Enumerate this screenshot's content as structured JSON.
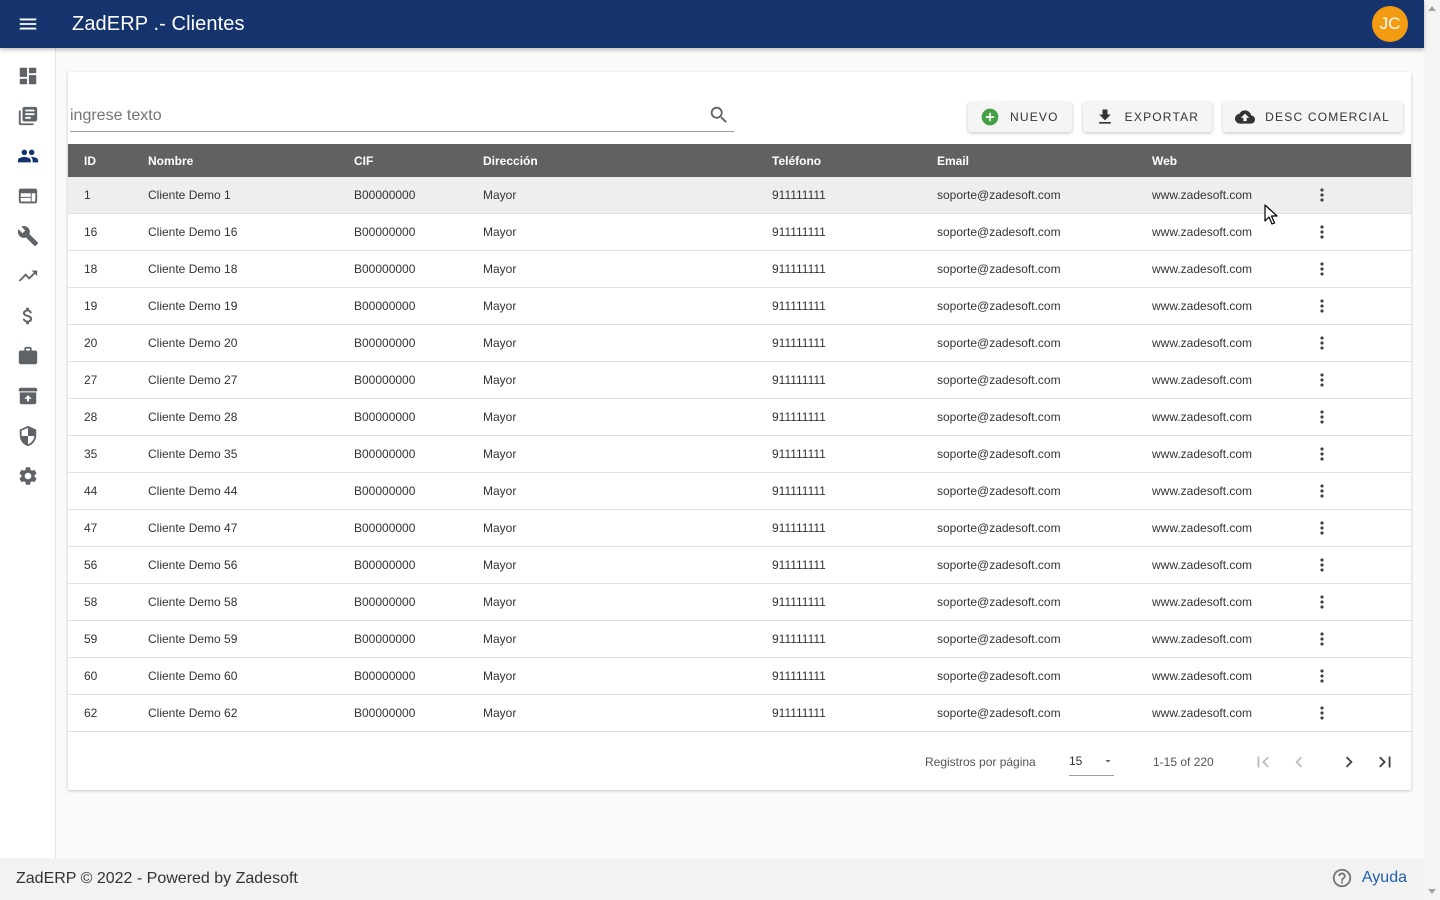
{
  "app": {
    "title": "ZadERP .- Clientes",
    "user_initials": "JC",
    "accent": "#15346e",
    "avatar_color": "#f39c12"
  },
  "sidebar": {
    "items": [
      {
        "name": "dashboard",
        "icon": "dashboard-icon"
      },
      {
        "name": "library",
        "icon": "library-books-icon"
      },
      {
        "name": "clients",
        "icon": "people-icon",
        "active": true
      },
      {
        "name": "web",
        "icon": "web-icon"
      },
      {
        "name": "tools",
        "icon": "wrench-icon"
      },
      {
        "name": "trending",
        "icon": "trending-up-icon"
      },
      {
        "name": "finance",
        "icon": "dollar-icon"
      },
      {
        "name": "business",
        "icon": "briefcase-icon"
      },
      {
        "name": "archive",
        "icon": "archive-upload-icon"
      },
      {
        "name": "security",
        "icon": "shield-icon"
      },
      {
        "name": "settings",
        "icon": "gear-icon"
      }
    ]
  },
  "search": {
    "placeholder": "ingrese texto",
    "value": ""
  },
  "toolbar": {
    "new_label": "NUEVO",
    "export_label": "EXPORTAR",
    "desc_label": "DESC COMERCIAL"
  },
  "table": {
    "columns": [
      "ID",
      "Nombre",
      "CIF",
      "Dirección",
      "Teléfono",
      "Email",
      "Web"
    ],
    "rows": [
      {
        "id": "1",
        "nombre": "Cliente Demo 1",
        "cif": "B00000000",
        "direccion": "Mayor",
        "telefono": "911111111",
        "email": "soporte@zadesoft.com",
        "web": "www.zadesoft.com"
      },
      {
        "id": "16",
        "nombre": "Cliente Demo 16",
        "cif": "B00000000",
        "direccion": "Mayor",
        "telefono": "911111111",
        "email": "soporte@zadesoft.com",
        "web": "www.zadesoft.com"
      },
      {
        "id": "18",
        "nombre": "Cliente Demo 18",
        "cif": "B00000000",
        "direccion": "Mayor",
        "telefono": "911111111",
        "email": "soporte@zadesoft.com",
        "web": "www.zadesoft.com"
      },
      {
        "id": "19",
        "nombre": "Cliente Demo 19",
        "cif": "B00000000",
        "direccion": "Mayor",
        "telefono": "911111111",
        "email": "soporte@zadesoft.com",
        "web": "www.zadesoft.com"
      },
      {
        "id": "20",
        "nombre": "Cliente Demo 20",
        "cif": "B00000000",
        "direccion": "Mayor",
        "telefono": "911111111",
        "email": "soporte@zadesoft.com",
        "web": "www.zadesoft.com"
      },
      {
        "id": "27",
        "nombre": "Cliente Demo 27",
        "cif": "B00000000",
        "direccion": "Mayor",
        "telefono": "911111111",
        "email": "soporte@zadesoft.com",
        "web": "www.zadesoft.com"
      },
      {
        "id": "28",
        "nombre": "Cliente Demo 28",
        "cif": "B00000000",
        "direccion": "Mayor",
        "telefono": "911111111",
        "email": "soporte@zadesoft.com",
        "web": "www.zadesoft.com"
      },
      {
        "id": "35",
        "nombre": "Cliente Demo 35",
        "cif": "B00000000",
        "direccion": "Mayor",
        "telefono": "911111111",
        "email": "soporte@zadesoft.com",
        "web": "www.zadesoft.com"
      },
      {
        "id": "44",
        "nombre": "Cliente Demo 44",
        "cif": "B00000000",
        "direccion": "Mayor",
        "telefono": "911111111",
        "email": "soporte@zadesoft.com",
        "web": "www.zadesoft.com"
      },
      {
        "id": "47",
        "nombre": "Cliente Demo 47",
        "cif": "B00000000",
        "direccion": "Mayor",
        "telefono": "911111111",
        "email": "soporte@zadesoft.com",
        "web": "www.zadesoft.com"
      },
      {
        "id": "56",
        "nombre": "Cliente Demo 56",
        "cif": "B00000000",
        "direccion": "Mayor",
        "telefono": "911111111",
        "email": "soporte@zadesoft.com",
        "web": "www.zadesoft.com"
      },
      {
        "id": "58",
        "nombre": "Cliente Demo 58",
        "cif": "B00000000",
        "direccion": "Mayor",
        "telefono": "911111111",
        "email": "soporte@zadesoft.com",
        "web": "www.zadesoft.com"
      },
      {
        "id": "59",
        "nombre": "Cliente Demo 59",
        "cif": "B00000000",
        "direccion": "Mayor",
        "telefono": "911111111",
        "email": "soporte@zadesoft.com",
        "web": "www.zadesoft.com"
      },
      {
        "id": "60",
        "nombre": "Cliente Demo 60",
        "cif": "B00000000",
        "direccion": "Mayor",
        "telefono": "911111111",
        "email": "soporte@zadesoft.com",
        "web": "www.zadesoft.com"
      },
      {
        "id": "62",
        "nombre": "Cliente Demo 62",
        "cif": "B00000000",
        "direccion": "Mayor",
        "telefono": "911111111",
        "email": "soporte@zadesoft.com",
        "web": "www.zadesoft.com"
      }
    ]
  },
  "paginator": {
    "per_page_label": "Registros por página",
    "per_page_value": "15",
    "range_label": "1-15 of 220"
  },
  "footer": {
    "text": "ZadERP © 2022 - Powered by Zadesoft",
    "help_label": "Ayuda"
  }
}
